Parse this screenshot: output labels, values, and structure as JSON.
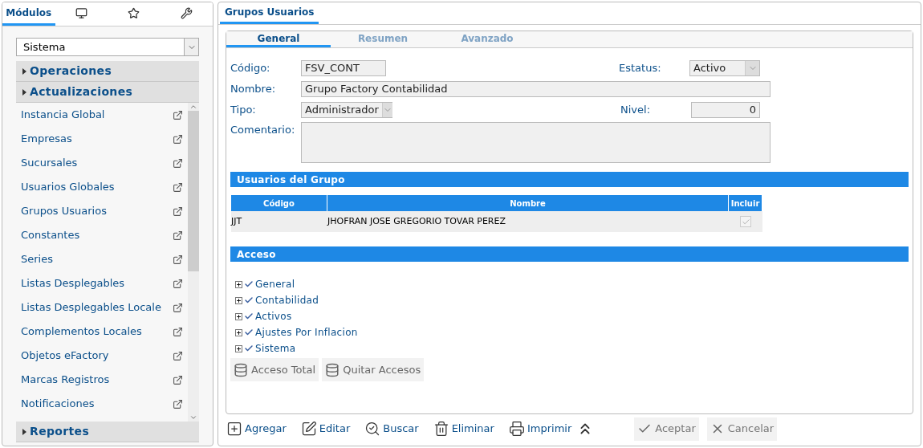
{
  "sidebar": {
    "tabs": [
      {
        "kind": "text",
        "label": "Módulos",
        "selected": true
      },
      {
        "kind": "monitor",
        "selected": false
      },
      {
        "kind": "star",
        "selected": false
      },
      {
        "kind": "tool",
        "selected": false
      }
    ],
    "module_select": {
      "value": "Sistema"
    },
    "sections_top": [
      {
        "label": "Operaciones",
        "expanded": false
      },
      {
        "label": "Actualizaciones",
        "expanded": false
      }
    ],
    "items": [
      "Instancia Global",
      "Empresas",
      "Sucursales",
      "Usuarios Globales",
      "Grupos Usuarios",
      "Constantes",
      "Series",
      "Listas Desplegables",
      "Listas Desplegables Locale",
      "Complementos Locales",
      "Objetos eFactory",
      "Marcas Registros",
      "Notificaciones"
    ],
    "sections_bottom": [
      {
        "label": "Reportes",
        "expanded": false
      }
    ]
  },
  "window": {
    "title": "Grupos Usuarios"
  },
  "tabs": [
    {
      "label": "General",
      "selected": true
    },
    {
      "label": "Resumen",
      "selected": false
    },
    {
      "label": "Avanzado",
      "selected": false
    }
  ],
  "form": {
    "codigo": {
      "label": "Código:",
      "value": "FSV_CONT"
    },
    "estatus": {
      "label": "Estatus:",
      "value": "Activo"
    },
    "nombre": {
      "label": "Nombre:",
      "value": "Grupo Factory Contabilidad"
    },
    "tipo": {
      "label": "Tipo:",
      "value": "Administrador"
    },
    "nivel": {
      "label": "Nivel:",
      "value": "0"
    },
    "comentario": {
      "label": "Comentario:"
    }
  },
  "users_section": {
    "title": "Usuarios del Grupo",
    "columns": [
      "Código",
      "Nombre",
      "Incluir"
    ],
    "rows": [
      {
        "codigo": "JJT",
        "nombre": "JHOFRAN JOSE GREGORIO TOVAR PEREZ",
        "incluir": true
      }
    ]
  },
  "access_section": {
    "title": "Acceso",
    "tree": [
      {
        "label": "General",
        "expanded": false,
        "checked": true
      },
      {
        "label": "Contabilidad",
        "expanded": false,
        "checked": true
      },
      {
        "label": "Activos",
        "expanded": false,
        "checked": true
      },
      {
        "label": "Ajustes Por Inflacion",
        "expanded": false,
        "checked": true
      },
      {
        "label": "Sistema",
        "expanded": false,
        "checked": true
      }
    ],
    "buttons": [
      "Acceso Total",
      "Quitar Accesos"
    ]
  },
  "toolbar": [
    {
      "kind": "add",
      "label": "Agregar"
    },
    {
      "kind": "edit",
      "label": "Editar"
    },
    {
      "kind": "search",
      "label": "Buscar"
    },
    {
      "kind": "delete",
      "label": "Eliminar"
    },
    {
      "kind": "print",
      "label": "Imprimir"
    }
  ],
  "dialog_buttons": [
    {
      "kind": "accept",
      "label": "Aceptar"
    },
    {
      "kind": "cancel",
      "label": "Cancelar"
    }
  ]
}
